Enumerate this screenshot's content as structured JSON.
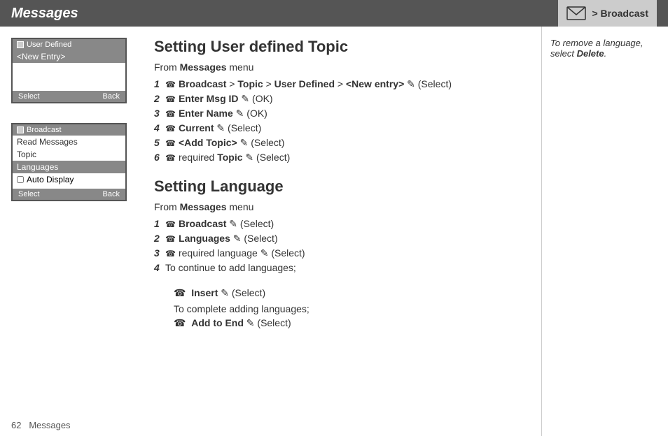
{
  "header": {
    "title": "Messages",
    "breadcrumb": "> Broadcast"
  },
  "sidebar": {
    "mockup1": {
      "titlebar": "User Defined",
      "item1": "<New Entry>",
      "btn_select": "Select",
      "btn_back": "Back"
    },
    "mockup2": {
      "titlebar": "Broadcast",
      "item1": "Read Messages",
      "item2": "Topic",
      "item3": "Languages",
      "item4": "Auto Display",
      "btn_select": "Select",
      "btn_back": "Back"
    }
  },
  "section1": {
    "title": "Setting User defined Topic",
    "from_text": "From ",
    "from_bold": "Messages",
    "from_rest": " menu",
    "steps": [
      {
        "num": "1",
        "icon": "☎",
        "parts": [
          {
            "text": "Broadcast",
            "bold": true
          },
          {
            "text": " > "
          },
          {
            "text": "Topic",
            "bold": true
          },
          {
            "text": " > "
          },
          {
            "text": "User Defined",
            "bold": true
          },
          {
            "text": " > "
          },
          {
            "text": "<New entry>",
            "bold": true
          },
          {
            "text": " ✎ (Select)"
          }
        ]
      },
      {
        "num": "2",
        "icon": "☎",
        "parts": [
          {
            "text": "Enter Msg ID",
            "bold": true
          },
          {
            "text": " ✎ (OK)"
          }
        ]
      },
      {
        "num": "3",
        "icon": "☎",
        "parts": [
          {
            "text": "Enter Name",
            "bold": true
          },
          {
            "text": " ✎ (OK)"
          }
        ]
      },
      {
        "num": "4",
        "icon": "☎",
        "parts": [
          {
            "text": "Current",
            "bold": true
          },
          {
            "text": " ✎ (Select)"
          }
        ]
      },
      {
        "num": "5",
        "icon": "☎",
        "parts": [
          {
            "text": "<Add Topic>",
            "bold": true
          },
          {
            "text": " ✎ (Select)"
          }
        ]
      },
      {
        "num": "6",
        "icon": "☎",
        "parts": [
          {
            "text": "required "
          },
          {
            "text": "Topic",
            "bold": true
          },
          {
            "text": " ✎ (Select)"
          }
        ]
      }
    ]
  },
  "section2": {
    "title": "Setting Language",
    "from_text": "From ",
    "from_bold": "Messages",
    "from_rest": " menu",
    "steps": [
      {
        "num": "1",
        "icon": "☎",
        "parts": [
          {
            "text": "Broadcast",
            "bold": true
          },
          {
            "text": " ✎ (Select)"
          }
        ]
      },
      {
        "num": "2",
        "icon": "☎",
        "parts": [
          {
            "text": "Languages",
            "bold": true
          },
          {
            "text": " ✎ (Select)"
          }
        ]
      },
      {
        "num": "3",
        "icon": "☎",
        "parts": [
          {
            "text": "required language ✎ (Select)"
          }
        ]
      },
      {
        "num": "4",
        "parts": [
          {
            "text": "To continue to add languages;"
          }
        ]
      }
    ],
    "insert_line": "☎  Insert ✎ (Select)",
    "complete_line": "To complete adding languages;",
    "add_to_end_line": "☎  Add to End ✎ (Select)"
  },
  "side_note": {
    "text": "To remove a language, select ",
    "bold": "Delete",
    "end": "."
  },
  "footer": {
    "page_num": "62",
    "page_label": "Messages"
  }
}
